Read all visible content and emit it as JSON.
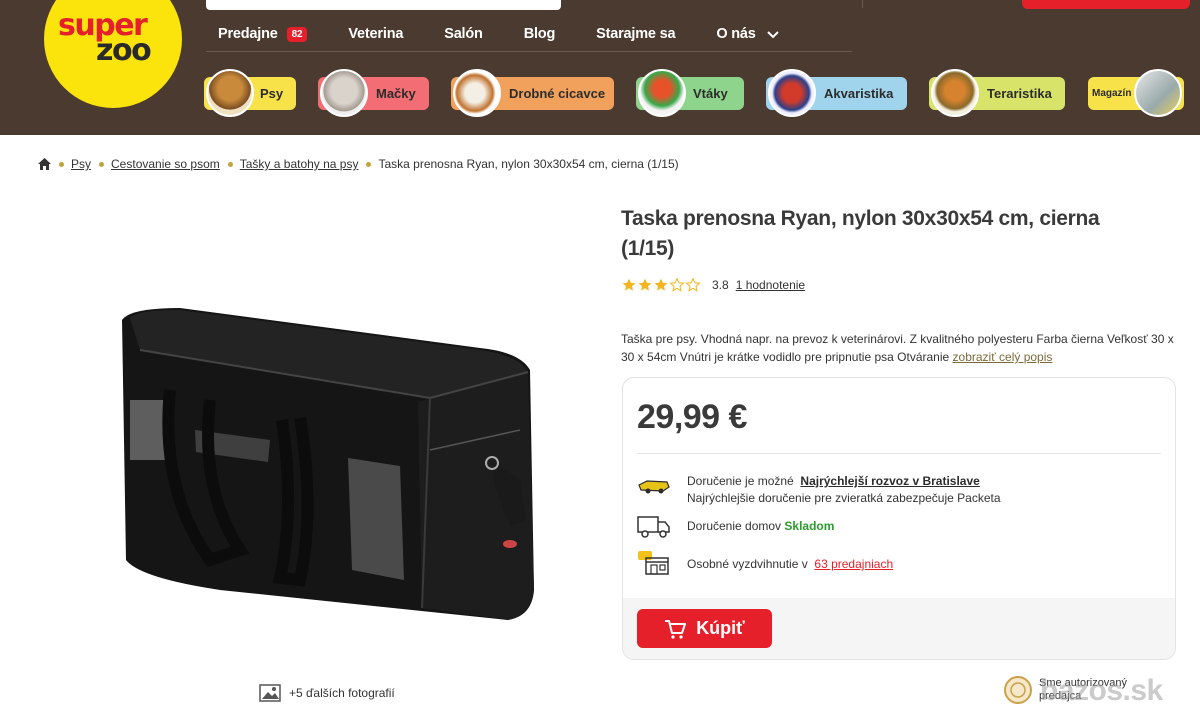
{
  "header": {
    "logo": {
      "line1": "super",
      "line2": "zoo"
    },
    "nav": [
      {
        "label": "Predajne",
        "badge": "82"
      },
      {
        "label": "Veterina"
      },
      {
        "label": "Salón"
      },
      {
        "label": "Blog"
      },
      {
        "label": "Starajme sa"
      },
      {
        "label": "O nás"
      }
    ],
    "categories": [
      {
        "label": "Psy",
        "color": "#f7e24a"
      },
      {
        "label": "Mačky",
        "color": "#f26d74"
      },
      {
        "label": "Drobné cicavce",
        "color": "#f2a15d"
      },
      {
        "label": "Vtáky",
        "color": "#8fd48c"
      },
      {
        "label": "Akvaristika",
        "color": "#9fd4ec"
      },
      {
        "label": "Teraristika",
        "color": "#d8e36a"
      },
      {
        "label": "Magazín",
        "color": "#f7e24a"
      }
    ]
  },
  "breadcrumb": {
    "items": [
      "Psy",
      "Cestovanie so psom",
      "Tašky a batohy na psy"
    ],
    "current": "Taska prenosna Ryan, nylon 30x30x54 cm, cierna (1/15)"
  },
  "gallery": {
    "more_photos": "+5 ďalších fotografií"
  },
  "product": {
    "title": "Taska prenosna Ryan, nylon 30x30x54 cm, cierna (1/15)",
    "rating_value": "3.8",
    "rating_stars": 3.8,
    "rating_count": "1 hodnotenie",
    "description": "Taška pre psy. Vhodná napr. na prevoz k veterinárovi. Z kvalitného polyesteru Farba čierna Veľkosť 30 x 30 x 54cm Vnútri je krátke vodidlo pre pripnutie psa Otváranie",
    "description_link": "zobraziť celý popis",
    "price": "29,99 €",
    "delivery": {
      "fast_label": "Doručenie je možné",
      "fast_link": "Najrýchlejší rozvoz v Bratislave",
      "fast_sub": "Najrýchlejšie doručenie pre zvieratká zabezpečuje Packeta",
      "home_label": "Doručenie domov",
      "home_status": "Skladom",
      "pickup_label": "Osobné vyzdvihnutie v",
      "pickup_link": "63 predajniach"
    },
    "buy_label": "Kúpiť"
  },
  "footer_badge": {
    "line1": "Sme autorizovaný",
    "line2": "predajca"
  },
  "watermark": "bazos.sk",
  "colors": {
    "header_bg": "#4a3a2f",
    "accent_red": "#e6202b",
    "logo_yellow": "#fbe30c",
    "stock_green": "#2d9a2d",
    "star": "#f2b51d"
  }
}
